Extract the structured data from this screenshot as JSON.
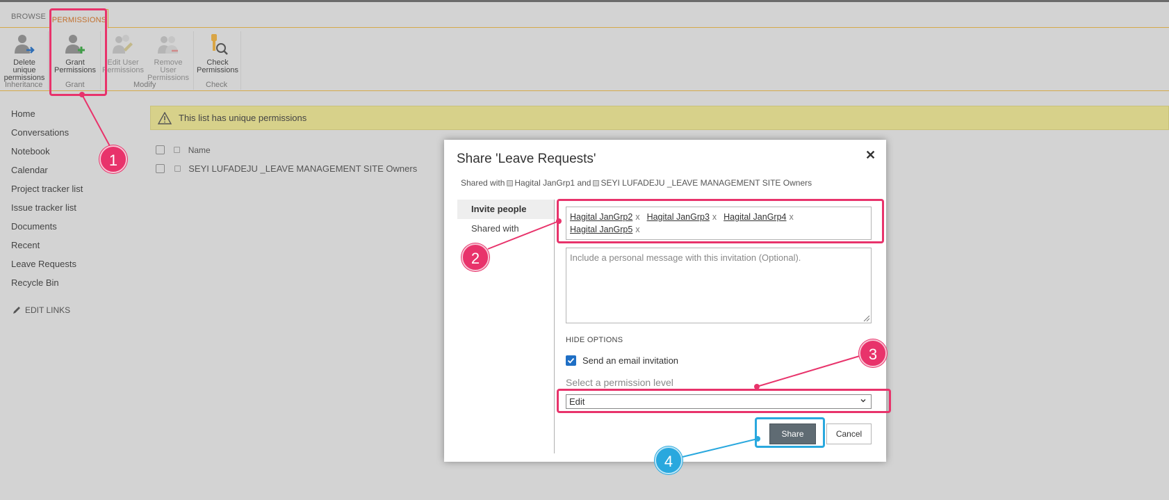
{
  "ribbon": {
    "tabs": [
      "BROWSE",
      "PERMISSIONS"
    ],
    "buttons": {
      "delete_unique": [
        "Delete unique",
        "permissions"
      ],
      "grant": [
        "Grant",
        "Permissions"
      ],
      "edit_user": [
        "Edit User",
        "Permissions"
      ],
      "remove_user": [
        "Remove User",
        "Permissions"
      ],
      "check": [
        "Check",
        "Permissions"
      ]
    },
    "groups": [
      "Inheritance",
      "Grant",
      "Modify",
      "Check"
    ]
  },
  "nav": {
    "items": [
      "Home",
      "Conversations",
      "Notebook",
      "Calendar",
      "Project tracker list",
      "Issue tracker list",
      "Documents",
      "Recent",
      "Leave Requests",
      "Recycle Bin"
    ],
    "edit_links": "EDIT LINKS"
  },
  "notice": {
    "text": "This list has unique permissions"
  },
  "list": {
    "header": "Name",
    "rows": [
      "SEYI LUFADEJU _LEAVE MANAGEMENT SITE Owners"
    ]
  },
  "dialog": {
    "title": "Share 'Leave Requests'",
    "close": "✕",
    "shared_with_prefix": "Shared with",
    "shared_with_1": "Hagital JanGrp1",
    "shared_with_and": "and",
    "shared_with_2": "SEYI LUFADEJU _LEAVE MANAGEMENT SITE Owners",
    "tabs": [
      "Invite people",
      "Shared with"
    ],
    "people": [
      "Hagital JanGrp2",
      "Hagital JanGrp3",
      "Hagital JanGrp4",
      "Hagital JanGrp5"
    ],
    "remove_mark": "x",
    "message_placeholder": "Include a personal message with this invitation (Optional).",
    "hide_options": "HIDE OPTIONS",
    "send_email_label": "Send an email invitation",
    "send_email_checked": true,
    "permission_label": "Select a permission level",
    "permission_value": "Edit",
    "share_button": "Share",
    "cancel_button": "Cancel"
  },
  "annotations": {
    "badges": [
      "1",
      "2",
      "3",
      "4"
    ],
    "colors": {
      "pink": "#e8336b",
      "blue": "#29a8de"
    }
  }
}
